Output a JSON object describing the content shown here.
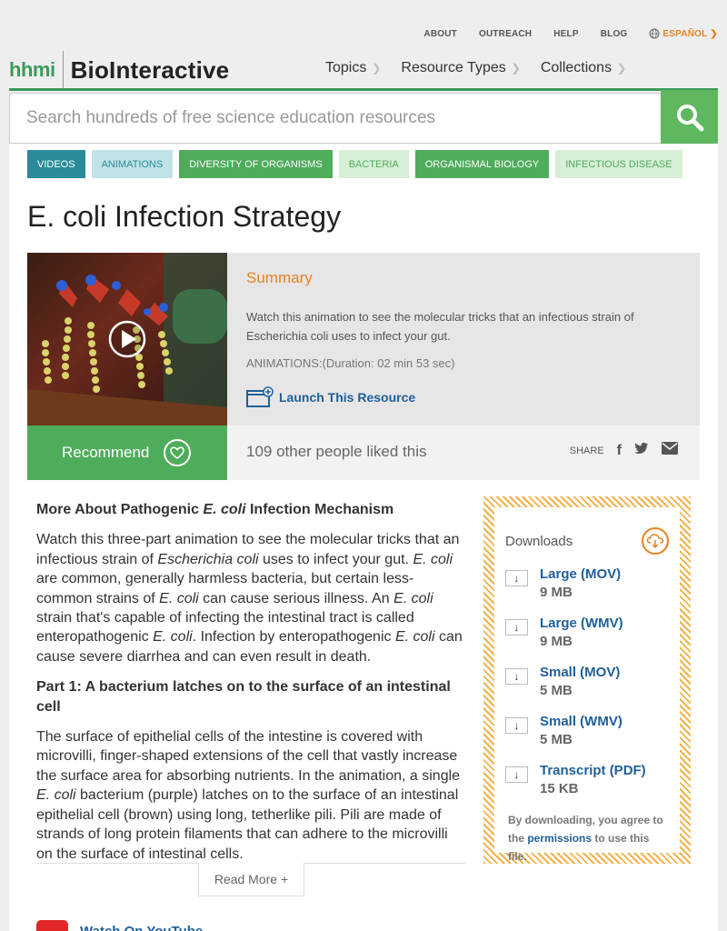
{
  "utility": {
    "links": [
      "ABOUT",
      "OUTREACH",
      "HELP",
      "BLOG"
    ],
    "language": "ESPAÑOL"
  },
  "header": {
    "logo_left": "hhmi",
    "logo_right": "BioInteractive",
    "nav": [
      "Topics",
      "Resource Types",
      "Collections"
    ]
  },
  "search": {
    "placeholder": "Search hundreds of free science education resources"
  },
  "tags": [
    {
      "label": "VIDEOS",
      "style": "dk-teal"
    },
    {
      "label": "ANIMATIONS",
      "style": "lt-teal"
    },
    {
      "label": "DIVERSITY OF ORGANISMS",
      "style": "dk-green"
    },
    {
      "label": "BACTERIA",
      "style": "lt-green"
    },
    {
      "label": "ORGANISMAL BIOLOGY",
      "style": "dk-green"
    },
    {
      "label": "INFECTIOUS DISEASE",
      "style": "lt-green"
    }
  ],
  "page_title": "E. coli Infection Strategy",
  "summary": {
    "heading": "Summary",
    "text": "Watch this animation to see the molecular tricks that an infectious strain of Escherichia coli uses to infect your gut.",
    "meta": "ANIMATIONS:(Duration: 02 min 53 sec)",
    "launch_label": "Launch This Resource"
  },
  "recommend": {
    "label": "Recommend",
    "liked_text": "109 other people liked this",
    "share_label": "SHARE"
  },
  "article": {
    "heading_pre": "More About Pathogenic ",
    "heading_italic": "E. coli",
    "heading_post": " Infection Mechanism",
    "p1_a": "Watch this three-part animation to see the molecular tricks that an infectious strain of ",
    "p1_b": "Escherichia coli",
    "p1_c": " uses to infect your gut. ",
    "p1_d": "E. coli",
    "p1_e": " are common, generally harmless bacteria, but certain less-common strains of ",
    "p1_f": "E. coli",
    "p1_g": " can cause serious illness. An ",
    "p1_h": "E. coli",
    "p1_i": " strain that's capable of infecting the intestinal tract is called enteropathogenic ",
    "p1_j": "E. coli",
    "p1_k": ". Infection by enteropathogenic ",
    "p1_l": "E. coli",
    "p1_m": " can cause severe diarrhea and can even result in death.",
    "part1": "Part 1: A bacterium latches on to the surface of an intestinal cell",
    "p2_a": "The surface of epithelial cells of the intestine is covered with microvilli, finger-shaped extensions of the cell that vastly increase the surface area for absorbing nutrients. In the animation, a single ",
    "p2_b": "E. coli",
    "p2_c": " bacterium (purple) latches on to the surface of an intestinal epithelial cell (brown) using long, tetherlike pili. Pili are made of strands of long protein filaments that can adhere to the microvilli on the surface of intestinal cells.",
    "read_more": "Read More +",
    "youtube": "Watch On YouTube"
  },
  "downloads": {
    "heading": "Downloads",
    "items": [
      {
        "name": "Large (MOV)",
        "size": "9 MB"
      },
      {
        "name": "Large (WMV)",
        "size": "9 MB"
      },
      {
        "name": "Small (MOV)",
        "size": "5 MB"
      },
      {
        "name": "Small (WMV)",
        "size": "5 MB"
      },
      {
        "name": "Transcript (PDF)",
        "size": "15 KB"
      }
    ],
    "note_pre": "By downloading, you agree to the ",
    "note_link": "permissions",
    "note_post": " to use this file."
  },
  "colors": {
    "brand_green": "#3a9a5a",
    "accent_orange": "#e8821e",
    "link_blue": "#1f5f9a"
  }
}
